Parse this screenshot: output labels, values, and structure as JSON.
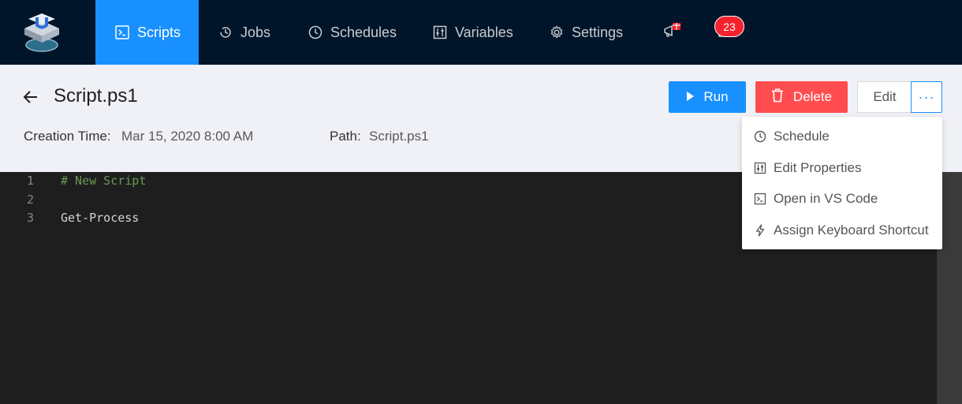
{
  "nav": {
    "items": [
      {
        "label": "Scripts",
        "icon": "terminal-icon",
        "active": true
      },
      {
        "label": "Jobs",
        "icon": "history-icon"
      },
      {
        "label": "Schedules",
        "icon": "clock-icon"
      },
      {
        "label": "Variables",
        "icon": "sliders-icon"
      },
      {
        "label": "Settings",
        "icon": "gear-icon"
      }
    ],
    "notification_count": "23",
    "accent_color": "#1890ff"
  },
  "script": {
    "title": "Script.ps1",
    "creation_time_label": "Creation Time:",
    "creation_time_value": "Mar 15, 2020 8:00 AM",
    "path_label": "Path:",
    "path_value": "Script.ps1"
  },
  "actions": {
    "run_label": "Run",
    "delete_label": "Delete",
    "edit_label": "Edit",
    "more_label": "···"
  },
  "menu": {
    "items": [
      {
        "label": "Schedule",
        "icon": "clock-icon"
      },
      {
        "label": "Edit Properties",
        "icon": "sliders-icon"
      },
      {
        "label": "Open in VS Code",
        "icon": "terminal-icon"
      },
      {
        "label": "Assign Keyboard Shortcut",
        "icon": "lightning-icon"
      }
    ]
  },
  "editor": {
    "lines": [
      {
        "number": "1",
        "text": "# New Script"
      },
      {
        "number": "2",
        "text": ""
      },
      {
        "number": "3",
        "text": "Get-Process"
      }
    ]
  }
}
